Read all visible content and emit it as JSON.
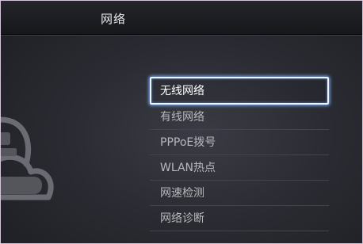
{
  "header": {
    "title": "网络"
  },
  "menu": {
    "items": [
      {
        "label": "无线网络",
        "selected": true
      },
      {
        "label": "有线网络",
        "selected": false
      },
      {
        "label": "PPPoE拨号",
        "selected": false
      },
      {
        "label": "WLAN热点",
        "selected": false
      },
      {
        "label": "网速检测",
        "selected": false
      },
      {
        "label": "网络诊断",
        "selected": false
      }
    ]
  },
  "colors": {
    "focus_border": "#eef4ff",
    "focus_glow": "#7fb3ff",
    "text_normal": "#b8b8bc",
    "text_selected": "#ffffff"
  },
  "icons": {
    "decor": "cloud-network-icon"
  }
}
